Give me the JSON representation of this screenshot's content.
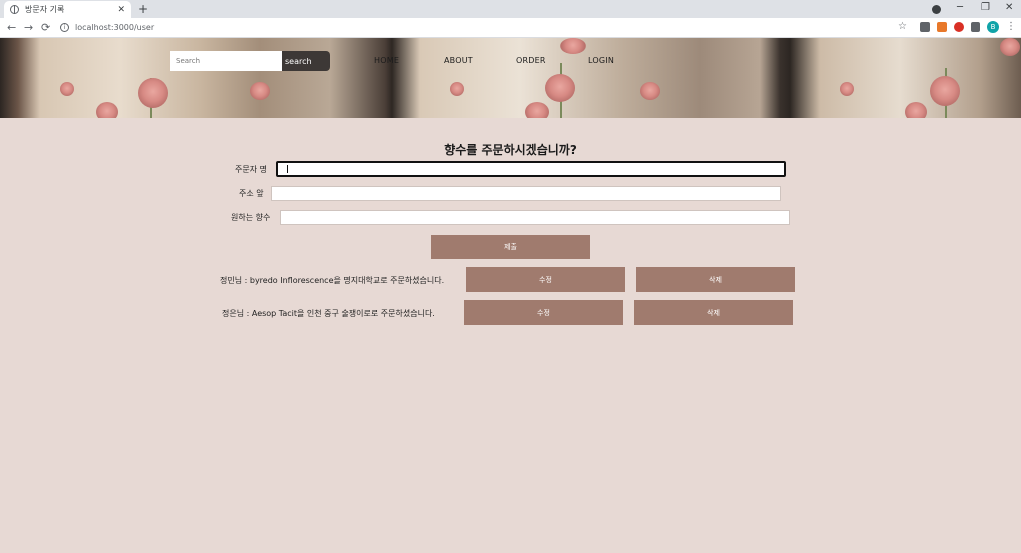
{
  "browser": {
    "tab_title": "방문자 기록",
    "tab_close": "✕",
    "new_tab": "+",
    "url": "localhost:3000/user",
    "avatar_letter": "B",
    "window_controls": {
      "minimize": "─",
      "restore": "❐",
      "close": "✕"
    }
  },
  "header": {
    "search_placeholder": "Search",
    "search_button": "search",
    "nav": [
      "HOME",
      "ABOUT",
      "ORDER",
      "LOGIN"
    ]
  },
  "form": {
    "title": "향수를 주문하시겠습니까?",
    "name_label": "주문자 명",
    "address_label": "주소 앞",
    "perfume_label": "원하는 향수",
    "submit_button": "제출"
  },
  "orders": [
    {
      "text": "정민님 : byredo Inflorescence을 명지대학교로 주문하셨습니다.",
      "edit": "수정",
      "delete": "삭제"
    },
    {
      "text": "정은님 : Aesop Tacit을 인천 중구 술쟁이로로 주문하셨습니다.",
      "edit": "수정",
      "delete": "삭제"
    }
  ],
  "colors": {
    "page_background": "#e7d9d4",
    "button": "#a07b6e",
    "search_button": "#3d3836"
  }
}
